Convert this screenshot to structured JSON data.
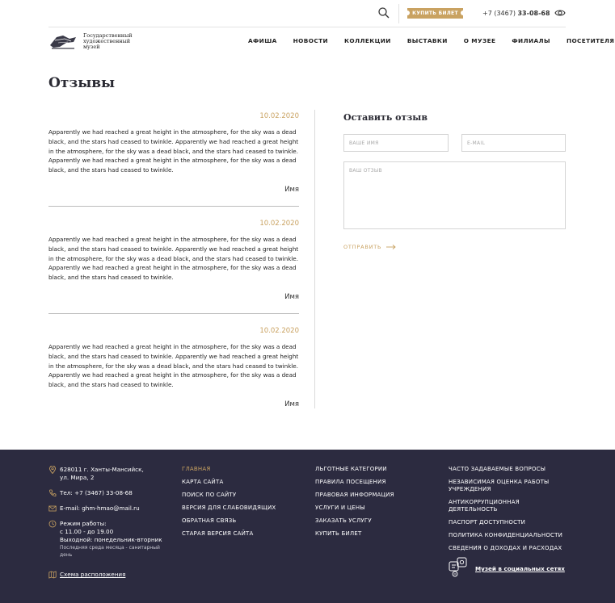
{
  "topbar": {
    "buy_ticket": "КУПИТЬ БИЛЕТ",
    "phone_prefix": "+7 (3467) ",
    "phone_number": "33-08-68",
    "icons": [
      "search-icon",
      "eye-icon"
    ]
  },
  "header": {
    "logo_text_1": "Государственный",
    "logo_text_2": "художественный",
    "logo_text_3": "музей",
    "nav": [
      "АФИША",
      "НОВОСТИ",
      "КОЛЛЕКЦИИ",
      "ВЫСТАВКИ",
      "О МУЗЕЕ",
      "ФИЛИАЛЫ",
      "ПОСЕТИТЕЛЯМ"
    ]
  },
  "page": {
    "title": "Отзывы"
  },
  "reviews": [
    {
      "date": "10.02.2020",
      "text": "Apparently we had reached a great height in the atmosphere, for the sky was a dead black, and the stars had ceased to twinkle. Apparently we had reached a great height in the atmosphere, for the sky was a dead black, and the stars had ceased to twinkle. Apparently we had reached a great height in the atmosphere, for the sky was a dead black, and the stars had ceased to twinkle.",
      "author": "Имя"
    },
    {
      "date": "10.02.2020",
      "text": "Apparently we had reached a great height in the atmosphere, for the sky was a dead black, and the stars had ceased to twinkle. Apparently we had reached a great height in the atmosphere, for the sky was a dead black, and the stars had ceased to twinkle. Apparently we had reached a great height in the atmosphere, for the sky was a dead black, and the stars had ceased to twinkle.",
      "author": "Имя"
    },
    {
      "date": "10.02.2020",
      "text": "Apparently we had reached a great height in the atmosphere, for the sky was a dead black, and the stars had ceased to twinkle. Apparently we had reached a great height in the atmosphere, for the sky was a dead black, and the stars had ceased to twinkle. Apparently we had reached a great height in the atmosphere, for the sky was a dead black, and the stars had ceased to twinkle.",
      "author": "Имя"
    }
  ],
  "form": {
    "title": "Оставить отзыв",
    "name_placeholder": "ВАШЕ ИМЯ",
    "email_placeholder": "E-MAIL",
    "review_placeholder": "ВАШ ОТЗЫВ",
    "submit": "ОТПРАВИТЬ"
  },
  "footer": {
    "address_1": "628011 г. Ханты-Мансийск,",
    "address_2": "ул. Мира, 2",
    "phone": "Тел: +7 (3467) 33-08-68",
    "email": "E-mail: ghm-hmao@mail.ru",
    "hours_1": "Режим работы:",
    "hours_2": "с 11.00 - до 19.00",
    "hours_3": "Выходной: понедельник-вторник",
    "hours_4": "Последняя среда месяца - санитарный день",
    "scheme": "Схема расположения",
    "col2": [
      "ГЛАВНАЯ",
      "КАРТА САЙТА",
      "ПОИСК ПО САЙТУ",
      "ВЕРСИЯ ДЛЯ СЛАБОВИДЯЩИХ",
      "ОБРАТНАЯ СВЯЗЬ",
      "СТАРАЯ ВЕРСИЯ САЙТА"
    ],
    "col3": [
      "ЛЬГОТНЫЕ КАТЕГОРИИ",
      "ПРАВИЛА ПОСЕЩЕНИЯ",
      "ПРАВОВАЯ ИНФОРМАЦИЯ",
      "УСЛУГИ И ЦЕНЫ",
      "ЗАКАЗАТЬ УСЛУГУ",
      "КУПИТЬ БИЛЕТ"
    ],
    "col4": [
      "ЧАСТО ЗАДАВАЕМЫЕ ВОПРОСЫ",
      "НЕЗАВИСИМАЯ ОЦЕНКА РАБОТЫ УЧРЕЖДЕНИЯ",
      "АНТИКОРРУПЦИОННАЯ ДЕЯТЕЛЬНОСТЬ",
      "ПАСПОРТ ДОСТУПНОСТИ",
      "ПОЛИТИКА КОНФИДЕНЦИАЛЬНОСТИ",
      "СВЕДЕНИЯ О ДОХОДАХ И РАСХОДАХ"
    ],
    "social": "Музей в социальных сетях"
  },
  "colors": {
    "accent": "#c9a261",
    "footer_bg": "#2c2b40",
    "text": "#2a2a33"
  }
}
